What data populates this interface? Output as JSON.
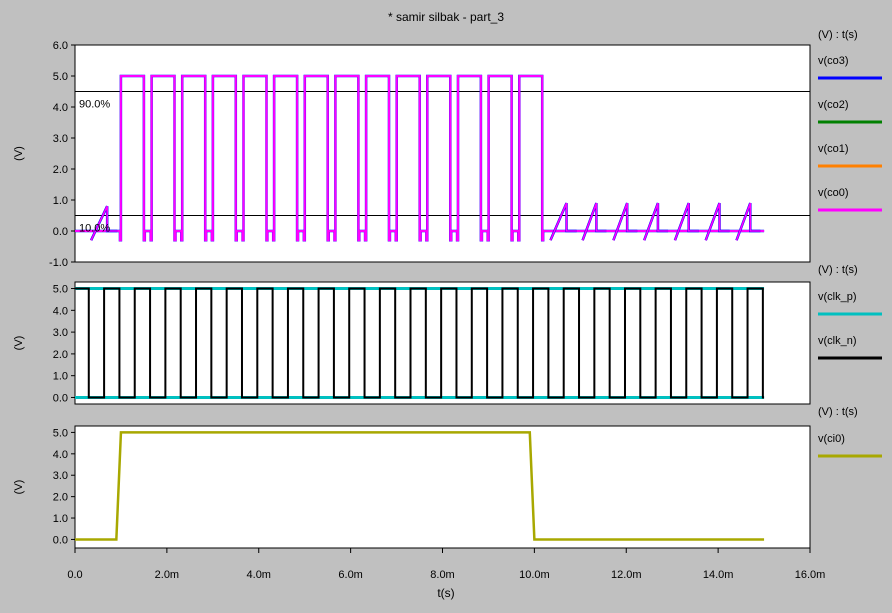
{
  "window": {
    "title": "* samir silbak - part_3"
  },
  "x_axis": {
    "label": "t(s)",
    "ticks": [
      {
        "v": 0,
        "label": "0.0"
      },
      {
        "v": 2,
        "label": "2.0m"
      },
      {
        "v": 4,
        "label": "4.0m"
      },
      {
        "v": 6,
        "label": "6.0m"
      },
      {
        "v": 8,
        "label": "8.0m"
      },
      {
        "v": 10,
        "label": "10.0m"
      },
      {
        "v": 12,
        "label": "12.0m"
      },
      {
        "v": 14,
        "label": "14.0m"
      },
      {
        "v": 16,
        "label": "16.0m"
      }
    ],
    "xlim": [
      0,
      16
    ]
  },
  "chart_data": [
    {
      "type": "line",
      "ylabel": "(V)",
      "ylim": [
        -1,
        6
      ],
      "yticks": [
        "-1.0",
        "0.0",
        "1.0",
        "2.0",
        "3.0",
        "4.0",
        "5.0",
        "6.0"
      ],
      "legend_header": "(V) : t(s)",
      "legend": [
        {
          "name": "v(co3)",
          "color": "#0000ff"
        },
        {
          "name": "v(co2)",
          "color": "#008000"
        },
        {
          "name": "v(co1)",
          "color": "#ff8000"
        },
        {
          "name": "v(co0)",
          "color": "#ff00ff"
        }
      ],
      "markers": [
        {
          "label": "90.0%",
          "y": 4.5
        },
        {
          "label": "10.0%",
          "y": 0.5
        }
      ],
      "pulse_train": {
        "series": "v(co0)",
        "first_high_start": 1.0,
        "period": 0.667,
        "high_duration": 0.5,
        "count": 14,
        "high": 5.0,
        "low": 0.0,
        "undershoot": -0.3
      },
      "ramps": [
        {
          "start": 0.35,
          "end": 0.7,
          "from": -0.3,
          "to": 0.8
        },
        {
          "start": 10.35,
          "end": 10.7,
          "from": -0.3,
          "to": 0.9
        },
        {
          "start": 11.05,
          "end": 11.35,
          "from": -0.3,
          "to": 0.9
        },
        {
          "start": 11.72,
          "end": 12.02,
          "from": -0.3,
          "to": 0.9
        },
        {
          "start": 12.39,
          "end": 12.69,
          "from": -0.3,
          "to": 0.9
        },
        {
          "start": 13.06,
          "end": 13.36,
          "from": -0.3,
          "to": 0.9
        },
        {
          "start": 13.73,
          "end": 14.03,
          "from": -0.3,
          "to": 0.9
        },
        {
          "start": 14.4,
          "end": 14.7,
          "from": -0.3,
          "to": 0.9
        }
      ],
      "sim_end": 15.0
    },
    {
      "type": "line",
      "ylabel": "(V)",
      "ylim": [
        -0.3,
        5.3
      ],
      "yticks": [
        "0.0",
        "1.0",
        "2.0",
        "3.0",
        "4.0",
        "5.0"
      ],
      "legend_header": "(V) : t(s)",
      "legend": [
        {
          "name": "v(clk_p)",
          "color": "#00c0c0"
        },
        {
          "name": "v(clk_n)",
          "color": "#000000"
        }
      ],
      "clock": {
        "period": 0.667,
        "start": 0.0,
        "end": 15.0,
        "high": 5.0,
        "low": 0.0
      }
    },
    {
      "type": "line",
      "ylabel": "(V)",
      "ylim": [
        -0.4,
        5.3
      ],
      "yticks": [
        "0.0",
        "1.0",
        "2.0",
        "3.0",
        "4.0",
        "5.0"
      ],
      "legend_header": "(V) : t(s)",
      "legend": [
        {
          "name": "v(ci0)",
          "color": "#a8a800"
        }
      ],
      "points": [
        [
          0,
          0
        ],
        [
          0.9,
          0
        ],
        [
          1.0,
          5
        ],
        [
          9.9,
          5
        ],
        [
          10.0,
          0
        ],
        [
          15.0,
          0
        ]
      ]
    }
  ]
}
